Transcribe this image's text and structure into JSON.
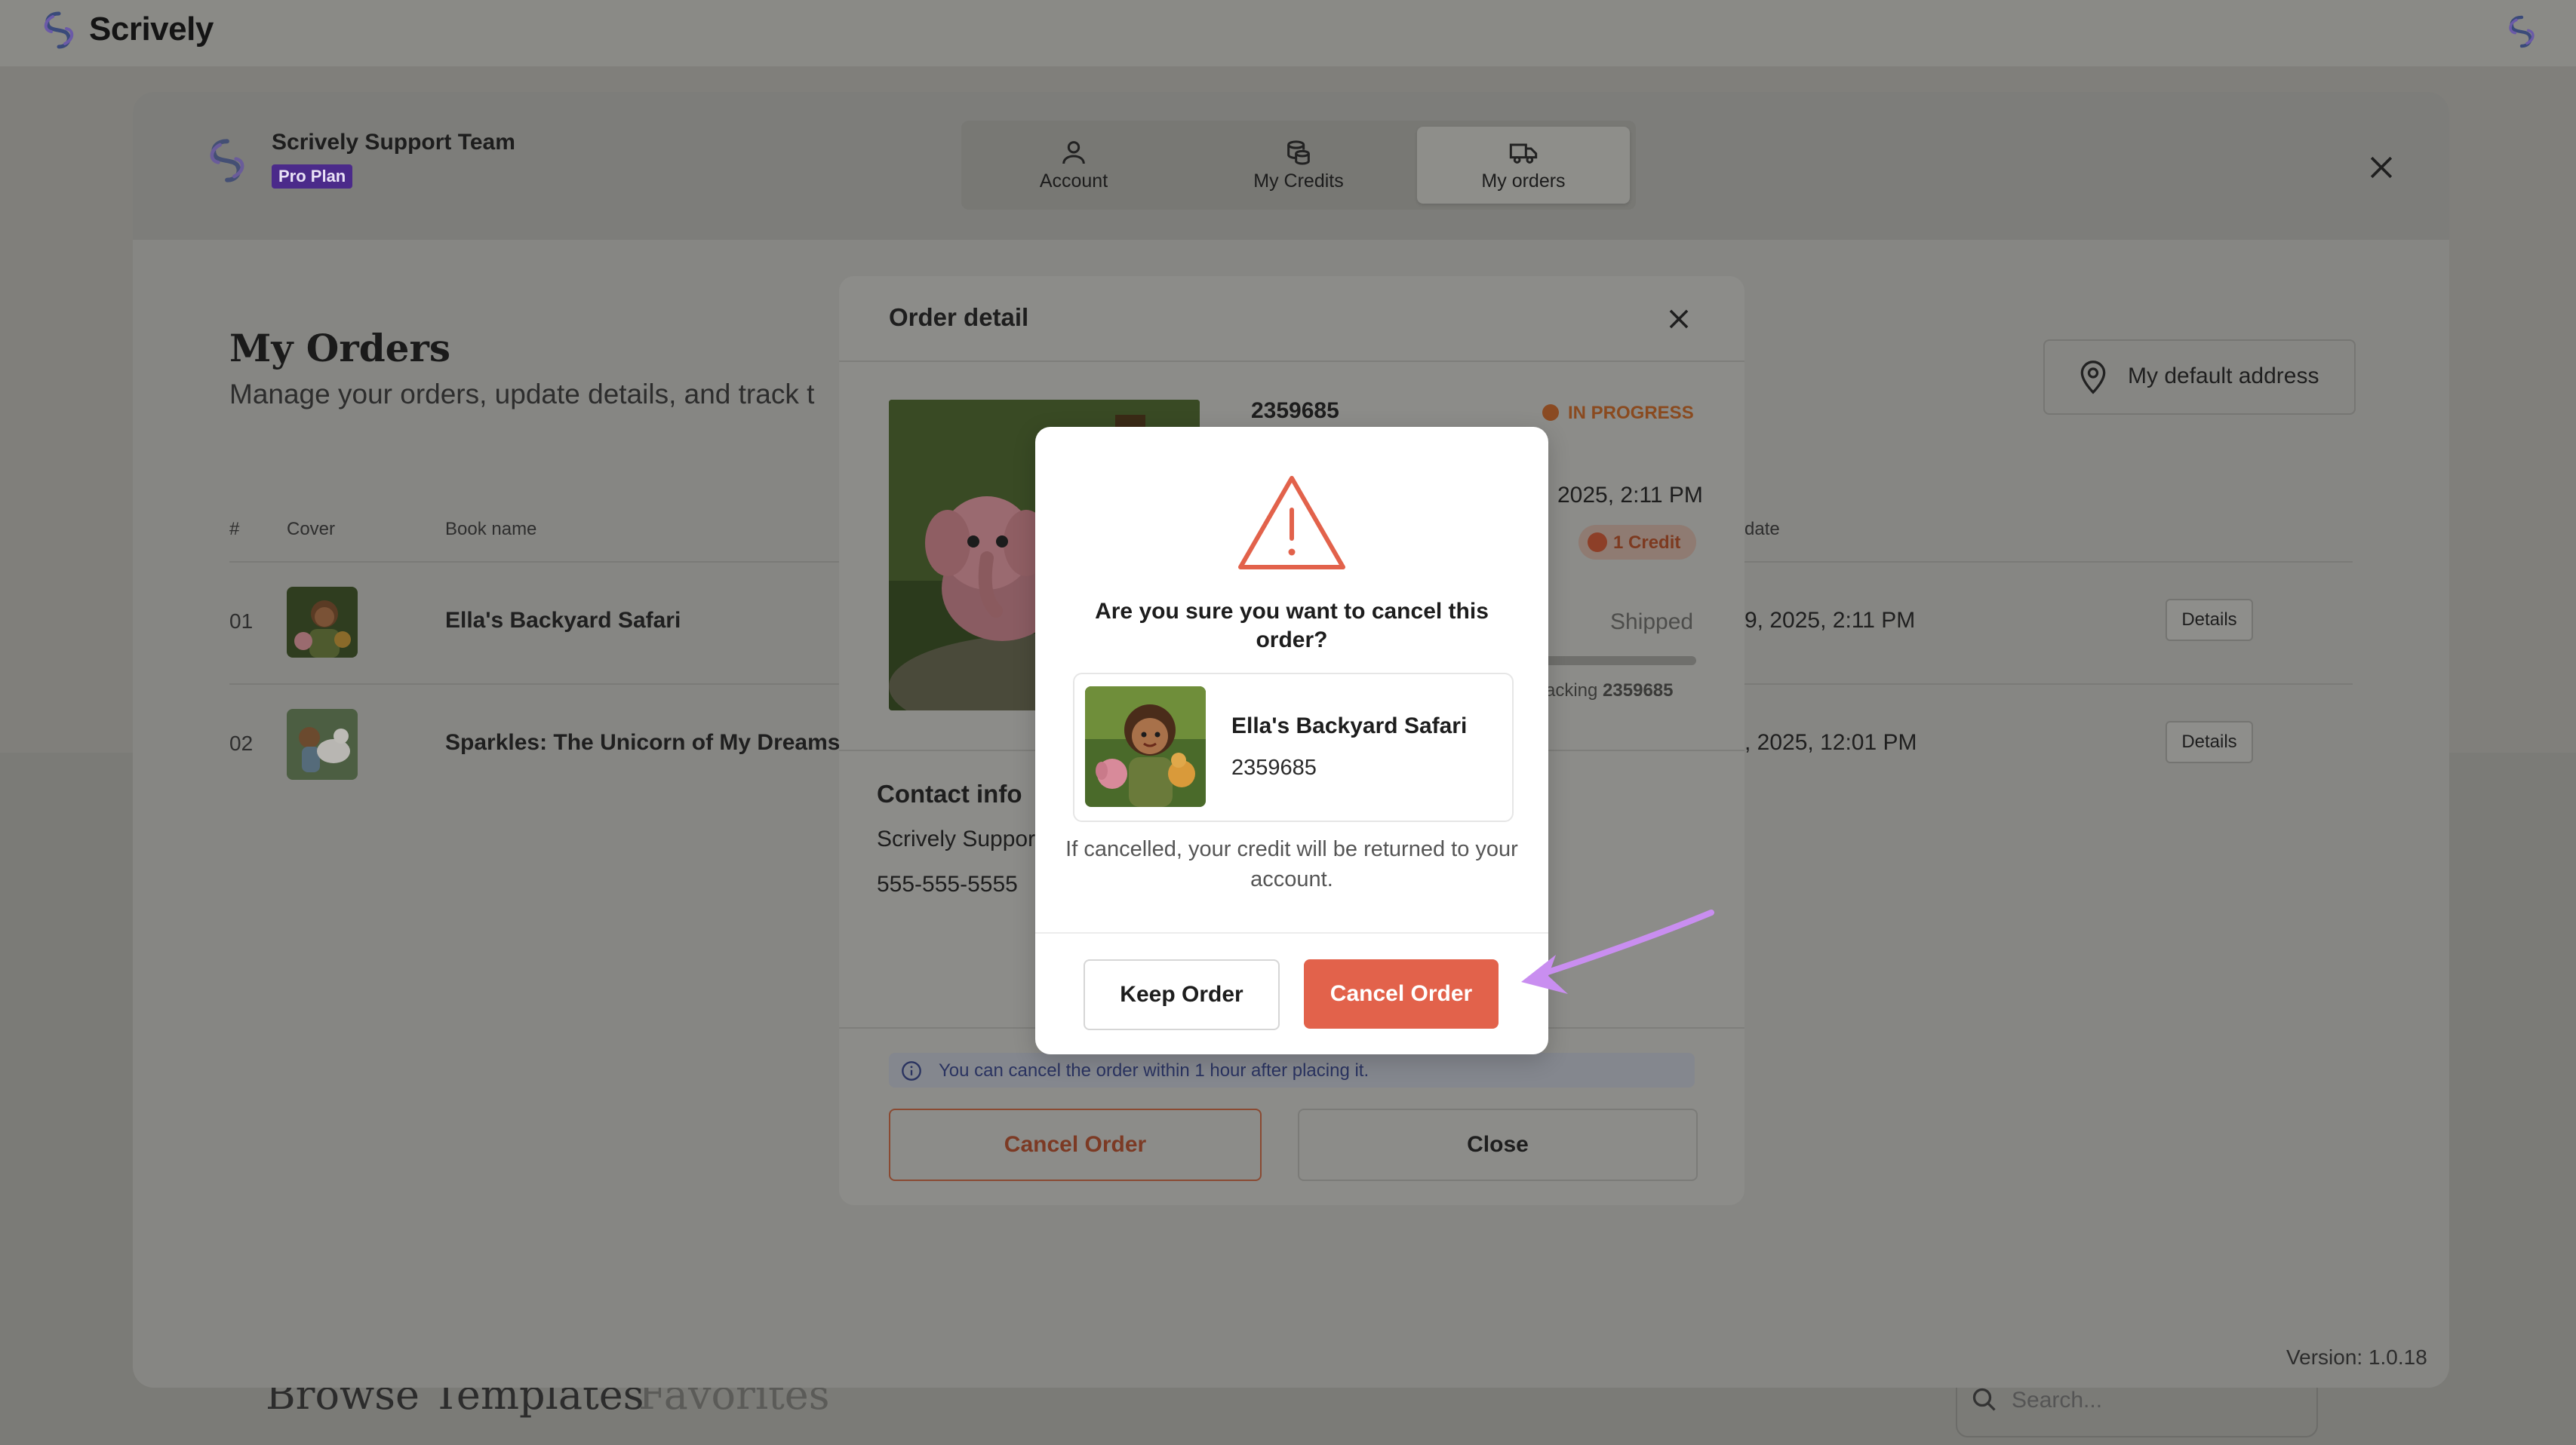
{
  "app": {
    "name": "Scrively"
  },
  "background": {
    "tabs": [
      "Browse Templates",
      "Favorites"
    ],
    "search_placeholder": "Search..."
  },
  "panel": {
    "team_name": "Scrively Support Team",
    "plan": "Pro Plan",
    "tabs": [
      {
        "label": "Account",
        "icon": "user-icon",
        "active": false
      },
      {
        "label": "My Credits",
        "icon": "coins-icon",
        "active": false
      },
      {
        "label": "My orders",
        "icon": "truck-icon",
        "active": true
      }
    ],
    "title": "My Orders",
    "subtitle": "Manage your orders, update details, and track t",
    "address_button": "My default address",
    "columns": {
      "num": "#",
      "cover": "Cover",
      "book": "Book name",
      "date": "date"
    },
    "rows": [
      {
        "num": "01",
        "name": "Ella's Backyard Safari",
        "date": "9, 2025, 2:11 PM",
        "action": "Details"
      },
      {
        "num": "02",
        "name": "Sparkles: The Unicorn of My Dreams",
        "date": ", 2025, 12:01 PM",
        "action": "Details"
      }
    ],
    "version": "Version: 1.0.18"
  },
  "order_detail": {
    "title": "Order detail",
    "order_id": "2359685",
    "status": "IN PROGRESS",
    "date": "2025, 2:11 PM",
    "credit": "1 Credit",
    "shipped": "Shipped",
    "tracking_prefix": "racking",
    "tracking_id": "2359685",
    "contact_title": "Contact info",
    "contact_name": "Scrively Suppor",
    "contact_phone": "555-555-5555",
    "info_text": "You can cancel the order within 1 hour after placing it.",
    "cancel_button": "Cancel Order",
    "close_button": "Close"
  },
  "confirm_dialog": {
    "question": "Are you sure you want to cancel this order?",
    "book_name": "Ella's Backyard Safari",
    "order_id": "2359685",
    "note": "If cancelled, your credit will be returned to your account.",
    "keep_button": "Keep Order",
    "cancel_button": "Cancel Order"
  },
  "colors": {
    "accent_red": "#e2624b",
    "plan_purple": "#4b2a8a",
    "annotation_arrow": "#c98ef0"
  }
}
